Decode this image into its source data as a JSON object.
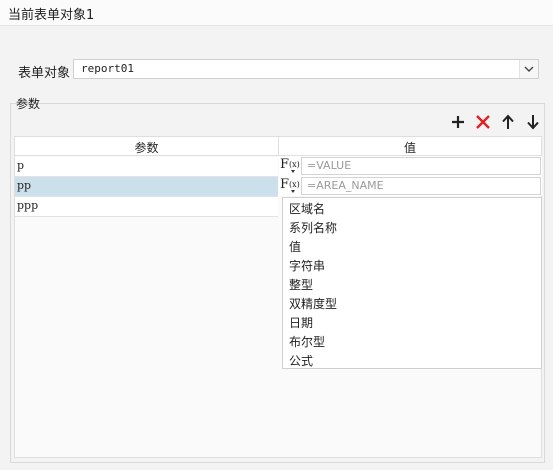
{
  "window": {
    "title": "当前表单对象1"
  },
  "form_object": {
    "label": "表单对象",
    "value": "report01"
  },
  "params": {
    "group_label": "参数",
    "columns": {
      "param": "参数",
      "value": "值"
    },
    "rows": [
      {
        "name": "p",
        "formula": "=VALUE",
        "selected": false
      },
      {
        "name": "pp",
        "formula": "=AREA_NAME",
        "selected": true
      },
      {
        "name": "ppp",
        "formula": "",
        "selected": false
      }
    ],
    "fx_label": "F",
    "fx_sub": "(x)"
  },
  "toolbar": {
    "add_icon": "plus-icon",
    "delete_icon": "red-x-icon",
    "up_icon": "arrow-up-icon",
    "down_icon": "arrow-down-icon",
    "delete_color": "#e02020"
  },
  "dropdown": {
    "items": [
      "区域名",
      "系列名称",
      "值",
      "字符串",
      "整型",
      "双精度型",
      "日期",
      "布尔型",
      "公式"
    ]
  }
}
